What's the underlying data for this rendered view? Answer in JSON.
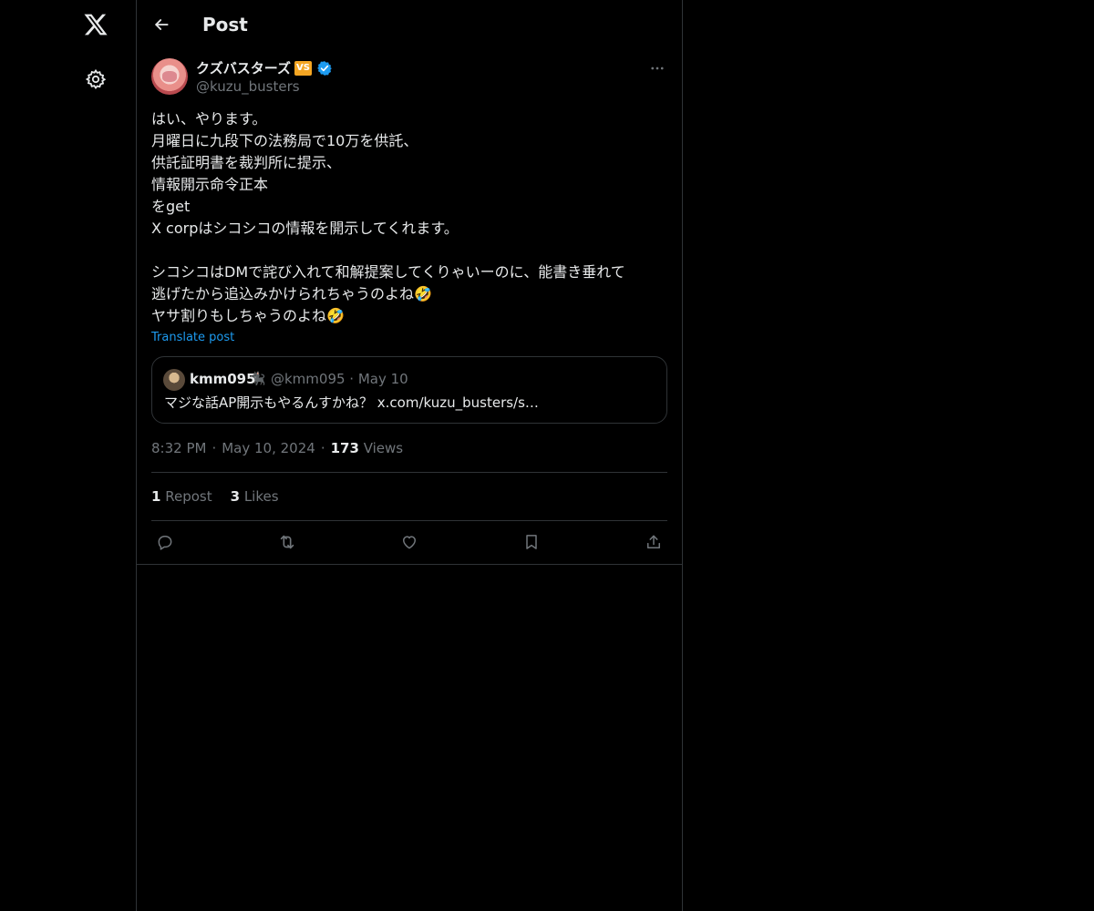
{
  "nav": {
    "logo_icon": "x-logo-icon",
    "settings_icon": "gear-icon"
  },
  "header": {
    "title": "Post"
  },
  "post": {
    "author": {
      "name": "クズバスターズ",
      "badge": "VS",
      "handle": "@kuzu_busters",
      "verified": true
    },
    "text": "はい、やります。\n月曜日に九段下の法務局で10万を供託、\n供託証明書を裁判所に提示、\n情報開示命令正本\nをget\nX corpはシコシコの情報を開示してくれます。\n\nシコシコはDMで詫び入れて和解提案してくりゃいーのに、能書き垂れて\n逃げたから追込みかけられちゃうのよね🤣\nヤサ割りもしちゃうのよね🤣",
    "translate_label": "Translate post",
    "quote": {
      "name": "kmm095",
      "emoji": "🐈‍⬛",
      "handle_date": "@kmm095 · May 10",
      "text": "マジな話AP開示もやるんすかね？ x.com/kuzu_busters/s…"
    },
    "time": "8:32 PM",
    "date": "May 10, 2024",
    "views_count": "173",
    "views_label": "Views",
    "reposts_count": "1",
    "reposts_label": "Repost",
    "likes_count": "3",
    "likes_label": "Likes",
    "sep": "·"
  },
  "colors": {
    "background": "#000000",
    "text": "#e7e9ea",
    "muted": "#71767b",
    "accent": "#1d9bf0",
    "border": "#2f3336",
    "badge": "#f5a623"
  }
}
